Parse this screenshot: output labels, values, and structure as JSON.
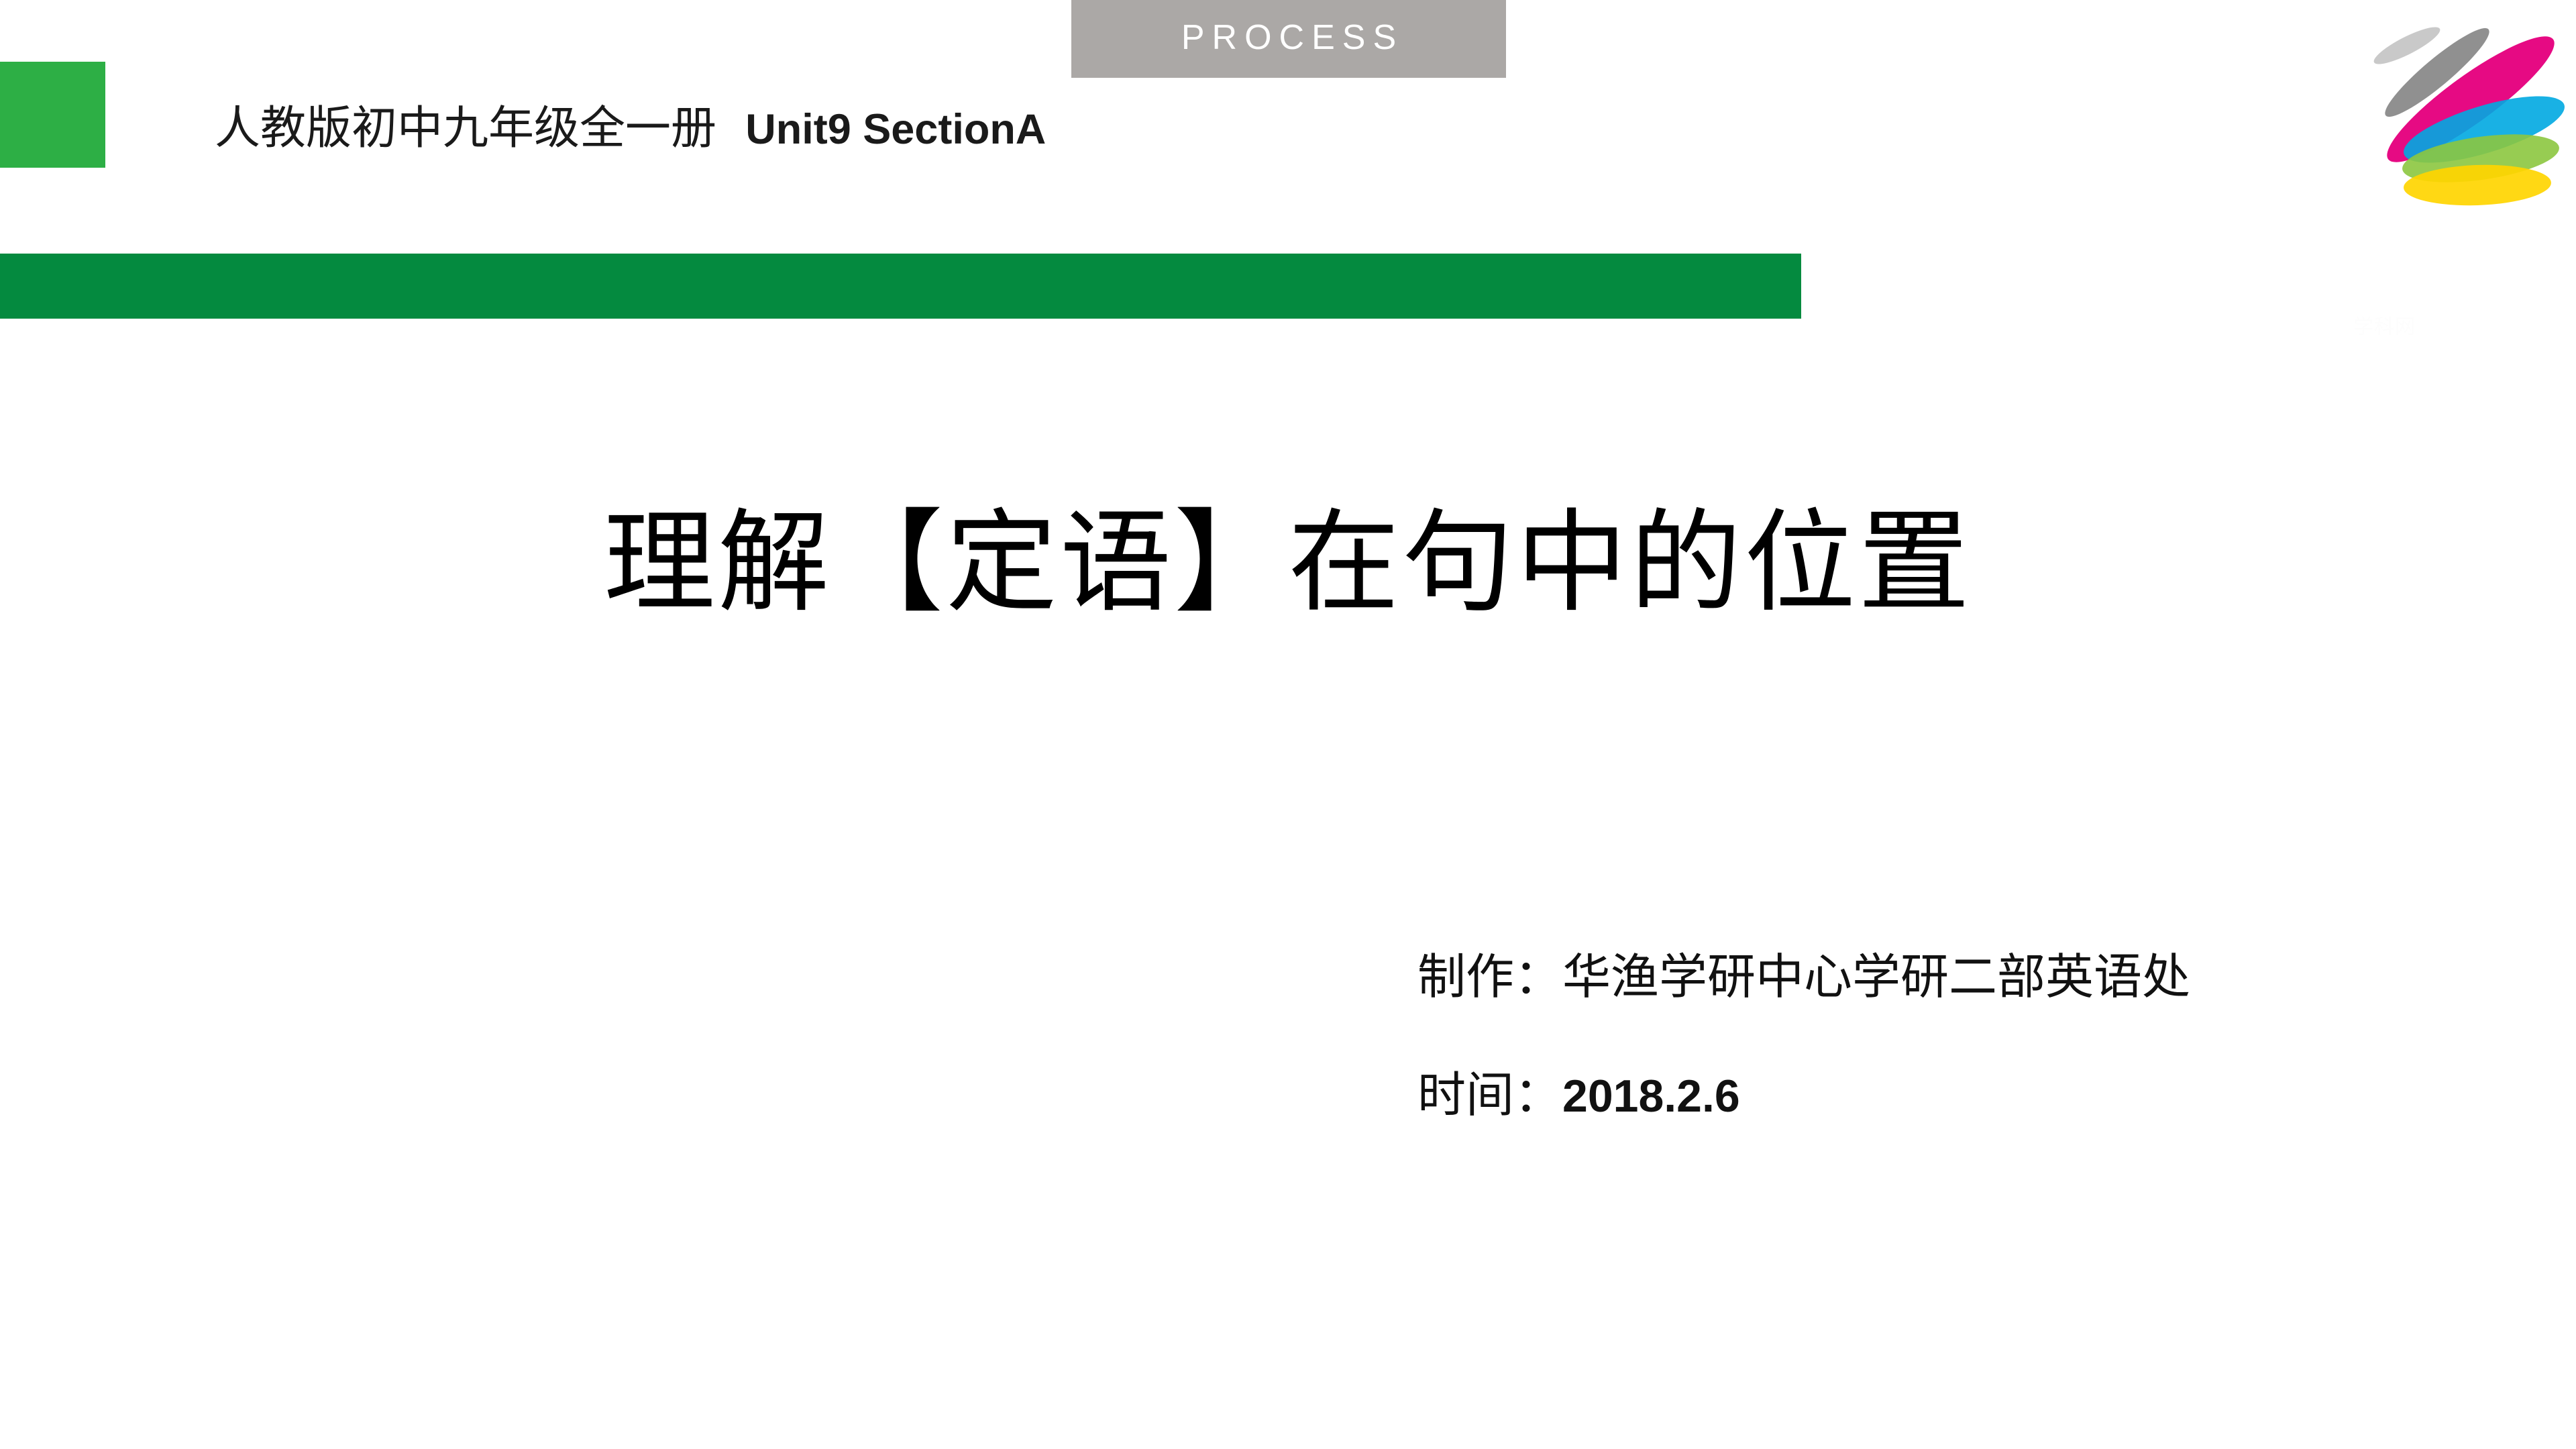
{
  "slide": {
    "background_color": "#FFFFFF",
    "banner": {
      "label": "PROCESS",
      "background_color": "#ABA8A6",
      "text_color": "#FFFFFF"
    },
    "accent_square": {
      "color": "#2DAF45"
    },
    "divider_bar": {
      "color": "#048A3F"
    },
    "header": {
      "course_cn": "人教版初中九年级全一册",
      "course_en": "Unit9 SectionA"
    },
    "title": "理解【定语】在句中的位置",
    "credits": {
      "author": "制作：华渔学研中心学研二部英语处",
      "date_label": "时间：",
      "date_value": "2018.2.6"
    },
    "watermark": "学科网",
    "logo": {
      "name": "huayu-leaf-logo",
      "petals": [
        {
          "name": "light-gray-petal",
          "color": "#C9C9C9"
        },
        {
          "name": "dark-gray-petal",
          "color": "#909090"
        },
        {
          "name": "magenta-petal",
          "color": "#E5007E"
        },
        {
          "name": "cyan-petal",
          "color": "#00A8E1"
        },
        {
          "name": "green-petal",
          "color": "#8CC63F"
        },
        {
          "name": "yellow-petal",
          "color": "#FFD500"
        }
      ]
    }
  }
}
